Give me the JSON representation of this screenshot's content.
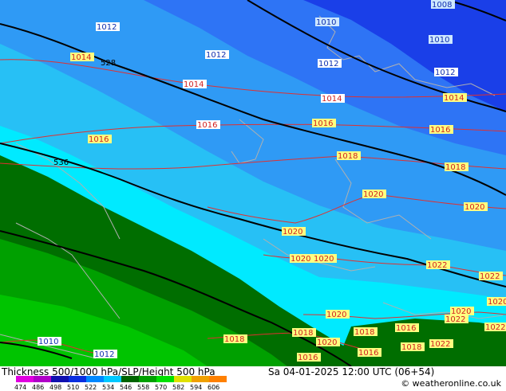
{
  "footer": {
    "title": "Thickness 500/1000 hPa/SLP/Height 500 hPa",
    "datetime": "Sa 04-01-2025 12:00 UTC (06+54)",
    "credit": "© weatheronline.co.uk"
  },
  "legend": {
    "ticks": [
      "474",
      "486",
      "498",
      "510",
      "522",
      "534",
      "546",
      "558",
      "570",
      "582",
      "594",
      "606"
    ],
    "colors": [
      "#e000e0",
      "#b000c8",
      "#1010b0",
      "#0a2ee0",
      "#0088ff",
      "#00c8ff",
      "#006400",
      "#00a000",
      "#00e000",
      "#e0e000",
      "#f0a000",
      "#ff8000"
    ]
  },
  "map": {
    "height_contours": [
      "528",
      "536"
    ],
    "pressure_labels": [
      "1008",
      "1010",
      "1010",
      "1012",
      "1012",
      "1012",
      "1012",
      "1014",
      "1014",
      "1014",
      "1014",
      "1016",
      "1016",
      "1016",
      "1016",
      "1018",
      "1018",
      "1020",
      "1020",
      "1020",
      "1020",
      "1020",
      "1022",
      "1022",
      "1022",
      "1018",
      "1018",
      "1016",
      "1020",
      "1020",
      "1018",
      "1020",
      "1018",
      "1016",
      "1016",
      "1022",
      "1020",
      "1022",
      "1010",
      "1012"
    ],
    "colors": {
      "dark_blue": "#1a3fe8",
      "blue": "#2e74f5",
      "mid_blue": "#2f9af5",
      "light_blue": "#27c0f5",
      "cyan": "#00eaff",
      "dark_green": "#006e00",
      "green": "#00a000",
      "bright_green": "#00c400",
      "isobar": "#e03030",
      "height_line": "#000000"
    }
  }
}
